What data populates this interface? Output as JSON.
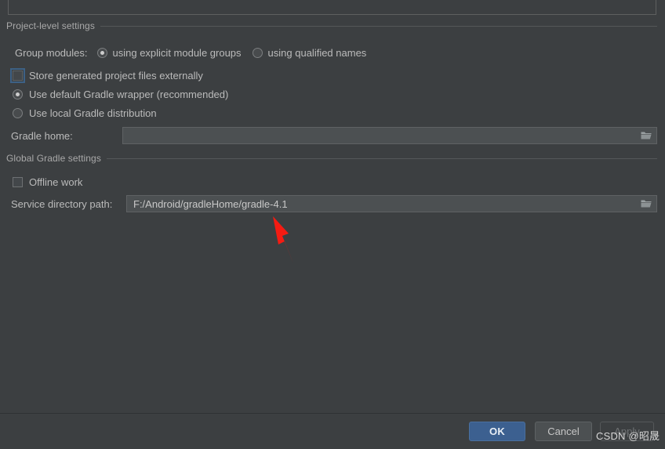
{
  "dialog": {
    "groups": [
      {
        "title": "Project-level settings"
      },
      {
        "title": "Global Gradle settings"
      }
    ],
    "group_modules": {
      "label": "Group modules:",
      "options": [
        {
          "label": "using explicit module groups",
          "selected": true
        },
        {
          "label": "using qualified names",
          "selected": false
        }
      ]
    },
    "store_generated": {
      "label": "Store generated project files externally",
      "checked": false,
      "focused": true
    },
    "gradle_source": [
      {
        "label": "Use default Gradle wrapper (recommended)",
        "selected": true
      },
      {
        "label": "Use local Gradle distribution",
        "selected": false
      }
    ],
    "gradle_home": {
      "label": "Gradle home:",
      "value": "",
      "browse_icon": "folder-icon"
    },
    "offline_work": {
      "label": "Offline work",
      "checked": false
    },
    "service_directory": {
      "label": "Service directory path:",
      "value": "F:/Android/gradleHome/gradle-4.1",
      "browse_icon": "folder-icon"
    },
    "buttons": {
      "ok": "OK",
      "cancel": "Cancel",
      "apply": "Apply"
    }
  },
  "annotation": {
    "arrow_color": "#f51b12"
  },
  "watermark": {
    "text": "CSDN @昭晟"
  }
}
